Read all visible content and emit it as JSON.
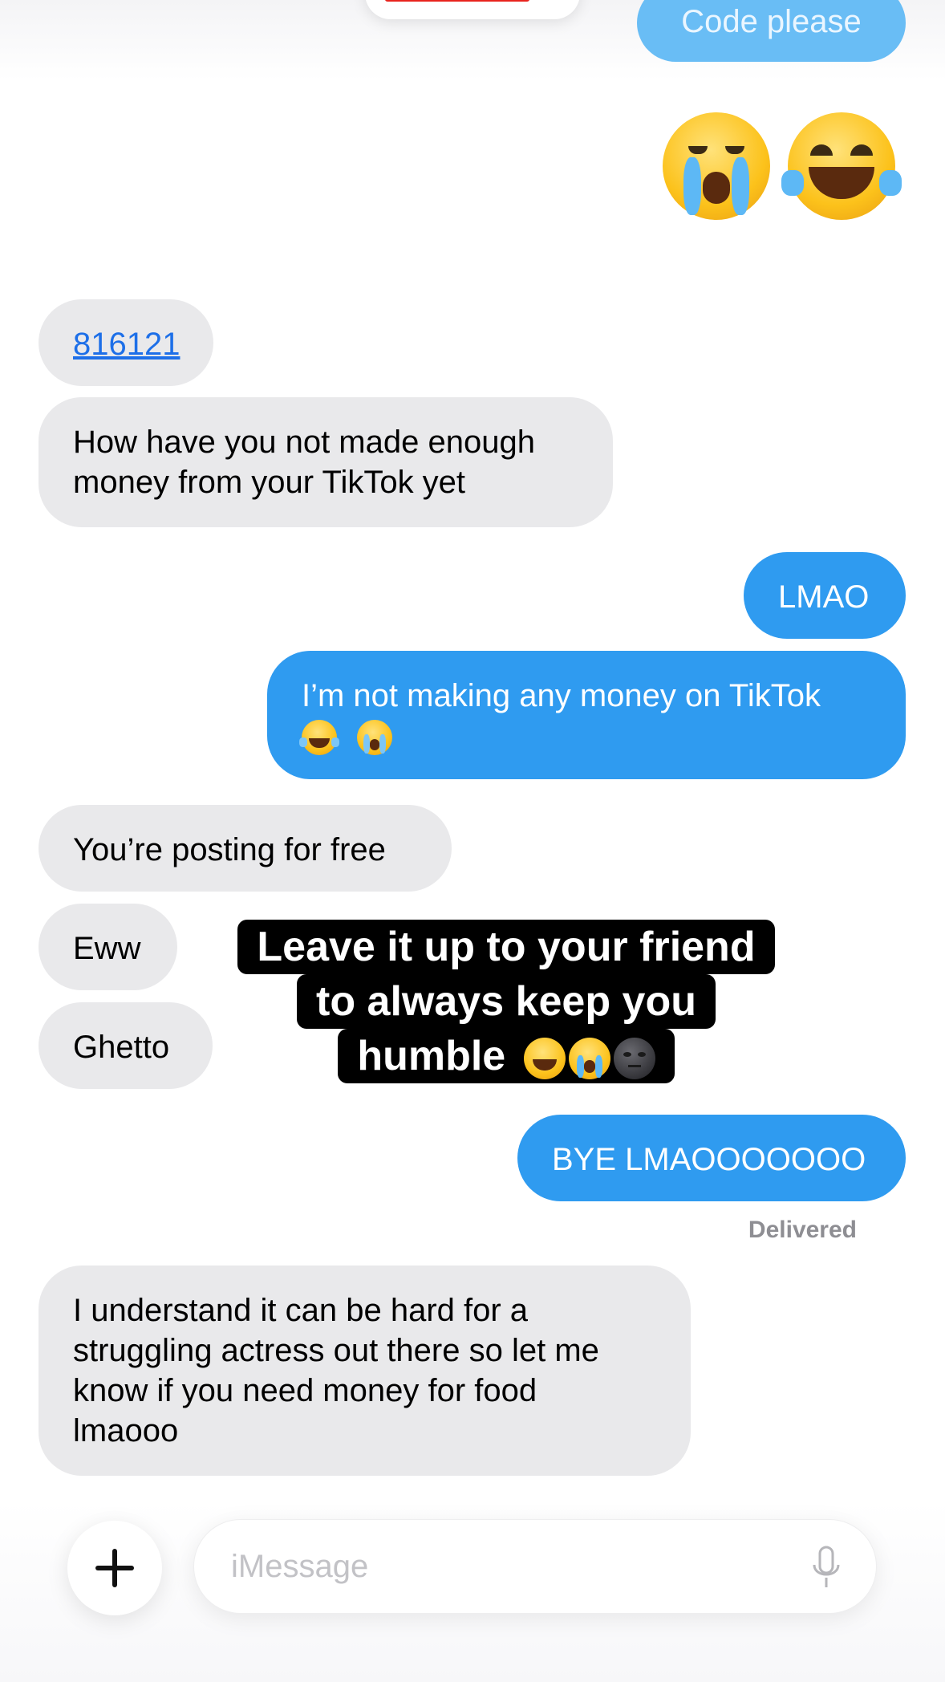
{
  "conversation": {
    "header_partial_message": "Code please",
    "emoji_message": [
      "crying-face",
      "laughing-face"
    ],
    "messages": [
      {
        "side": "incoming",
        "text": "816121",
        "is_link": true
      },
      {
        "side": "incoming",
        "lines": [
          "How have you not made enough",
          "money from your TikTok yet"
        ]
      },
      {
        "side": "outgoing",
        "text": "LMAO"
      },
      {
        "side": "outgoing",
        "lines": [
          "I’m not making any money on TikTok"
        ],
        "emojis": [
          "laughing-face",
          "crying-face"
        ]
      },
      {
        "side": "incoming",
        "text": "You’re posting for free"
      },
      {
        "side": "incoming",
        "text": "Eww"
      },
      {
        "side": "incoming",
        "text": "Ghetto"
      },
      {
        "side": "outgoing",
        "text": "BYE LMAOOOOOOO"
      },
      {
        "side": "incoming",
        "lines": [
          "I understand it can be hard for a",
          "struggling actress out there so let me",
          "know if you need money for food",
          "lmaooo"
        ]
      }
    ],
    "delivered_label": "Delivered"
  },
  "overlay_caption": {
    "lines": [
      "Leave it up to your friend",
      "to always keep you",
      "humble"
    ],
    "emojis": [
      "laughing-face",
      "crying-face",
      "new-moon-face"
    ]
  },
  "compose": {
    "placeholder": "iMessage"
  },
  "colors": {
    "outgoing_bubble": "#2f9bf0",
    "incoming_bubble": "#e9e9eb",
    "link": "#1d6fe8",
    "delivered": "#8e8e93"
  }
}
